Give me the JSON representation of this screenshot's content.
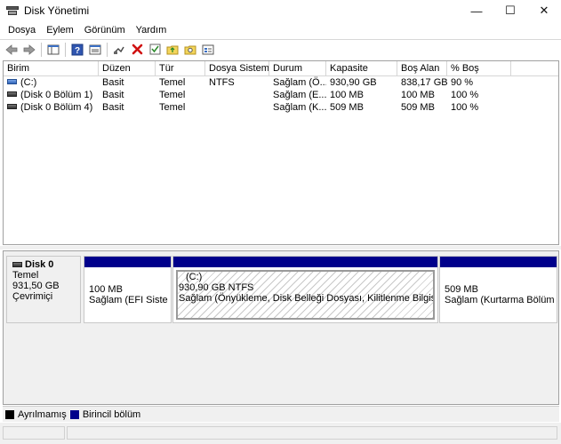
{
  "window": {
    "title": "Disk Yönetimi",
    "minimize_glyph": "—",
    "maximize_glyph": "☐",
    "close_glyph": "✕"
  },
  "menu": [
    "Dosya",
    "Eylem",
    "Görünüm",
    "Yardım"
  ],
  "toolbar": {
    "icons": [
      "back-arrow-icon",
      "forward-arrow-icon",
      "console-tree-icon",
      "help-icon",
      "properties-icon",
      "connect-icon",
      "delete-icon",
      "check-icon",
      "folder-up-icon",
      "search-folder-icon",
      "drive-list-icon"
    ]
  },
  "columns": [
    "Birim",
    "Düzen",
    "Tür",
    "Dosya Sistemi",
    "Durum",
    "Kapasite",
    "Boş Alan",
    "% Boş"
  ],
  "volumes": [
    {
      "birim": "(C:)",
      "duzen": "Basit",
      "tur": "Temel",
      "fs": "NTFS",
      "durum": "Sağlam (Ö...",
      "kapasite": "930,90 GB",
      "bos": "838,17 GB",
      "yuzde": "90 %",
      "icon": "blue"
    },
    {
      "birim": "(Disk 0 Bölüm 1)",
      "duzen": "Basit",
      "tur": "Temel",
      "fs": "",
      "durum": "Sağlam (E...",
      "kapasite": "100 MB",
      "bos": "100 MB",
      "yuzde": "100 %",
      "icon": "gray"
    },
    {
      "birim": "(Disk 0 Bölüm 4)",
      "duzen": "Basit",
      "tur": "Temel",
      "fs": "",
      "durum": "Sağlam (K...",
      "kapasite": "509 MB",
      "bos": "509 MB",
      "yuzde": "100 %",
      "icon": "gray"
    }
  ],
  "disk": {
    "name": "Disk 0",
    "type": "Temel",
    "size": "931,50 GB",
    "status": "Çevrimiçi",
    "partitions": [
      {
        "title": "",
        "size": "100 MB",
        "status": "Sağlam (EFI Sistem B"
      },
      {
        "title": "(C:)",
        "size": "930,90 GB NTFS",
        "status": "Sağlam (Önyükleme, Disk Belleği Dosyası, Kilitlenme Bilgisi, Temel"
      },
      {
        "title": "",
        "size": "509 MB",
        "status": "Sağlam (Kurtarma Bölümü)"
      }
    ]
  },
  "legend": [
    {
      "label": "Ayrılmamış",
      "color": "#000000"
    },
    {
      "label": "Birincil bölüm",
      "color": "#00008b"
    }
  ],
  "colors": {
    "primary_partition": "#00008b",
    "unallocated": "#000000"
  }
}
